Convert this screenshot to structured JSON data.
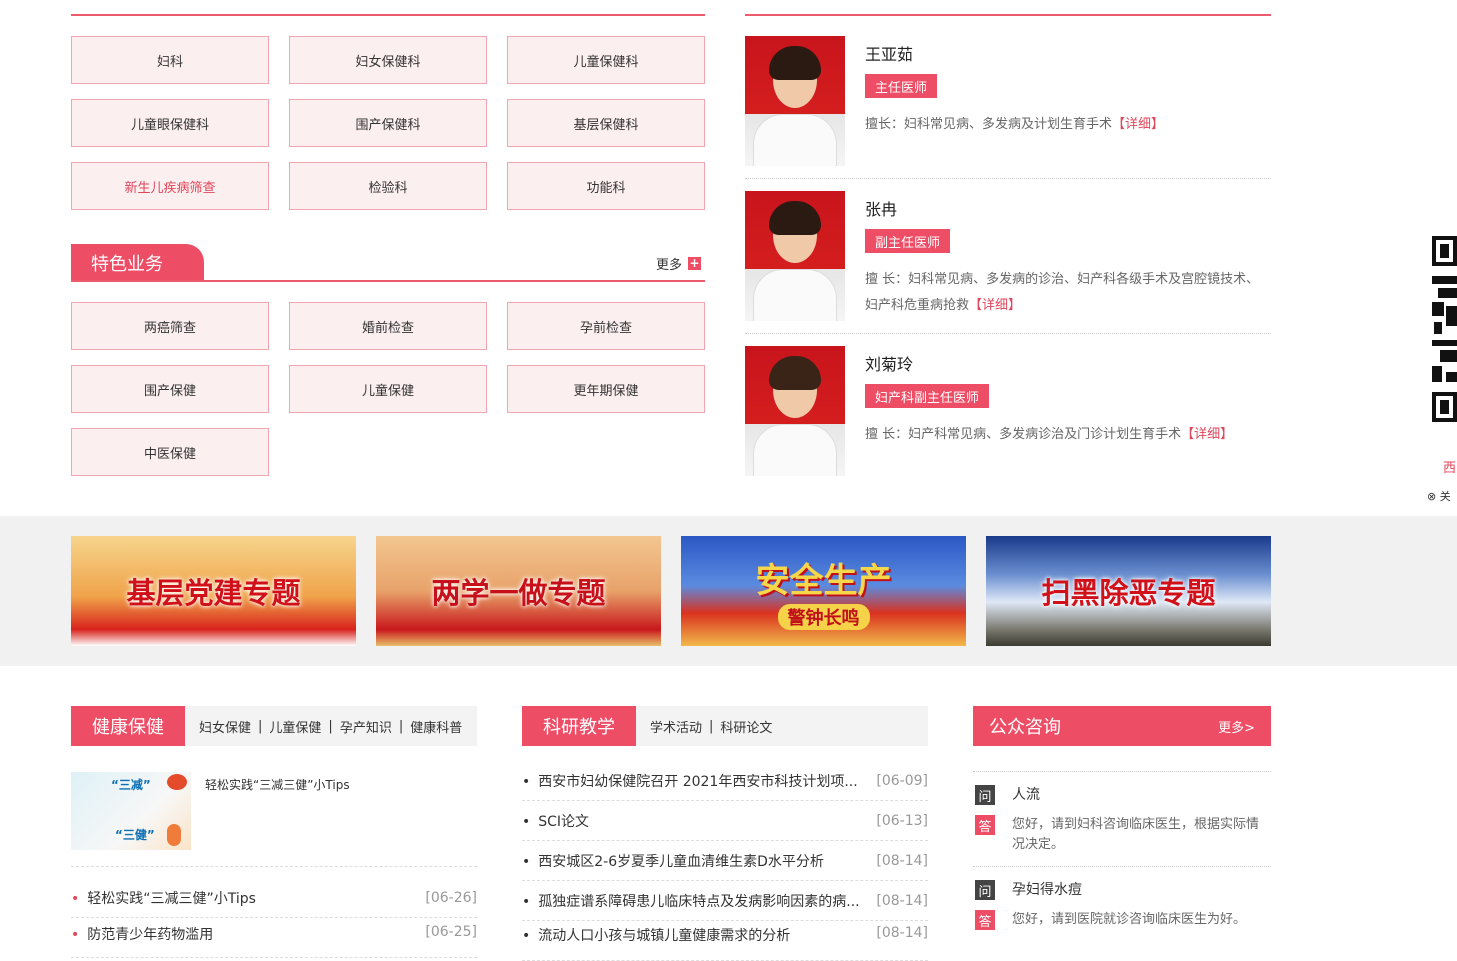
{
  "departments": {
    "items": [
      "妇科",
      "妇女保健科",
      "儿童保健科",
      "儿童眼保健科",
      "围产保健科",
      "基层保健科",
      "新生儿疾病筛查",
      "检验科",
      "功能科"
    ]
  },
  "specialty": {
    "title": "特色业务",
    "more": "更多",
    "items": [
      "两癌筛查",
      "婚前检查",
      "孕前检查",
      "围产保健",
      "儿童保健",
      "更年期保健",
      "中医保健"
    ]
  },
  "doctors": [
    {
      "name": "王亚茹",
      "title": "主任医师",
      "desc": "擅长：妇科常见病、多发病及计划生育手术",
      "detail": "【详细】"
    },
    {
      "name": "张冉",
      "title": "副主任医师",
      "desc": "擅 长：妇科常见病、多发病的诊治、妇产科各级手术及宫腔镜技术、妇产科危重病抢救",
      "detail": "【详细】"
    },
    {
      "name": "刘菊玲",
      "title": "妇产科副主任医师",
      "desc": "擅 长：妇产科常见病、多发病诊治及门诊计划生育手术",
      "detail": "【详细】"
    }
  ],
  "banners": [
    "基层党建专题",
    "两学一做专题",
    "安全生产",
    "扫黑除恶专题"
  ],
  "banner_sub": "警钟长鸣",
  "health": {
    "tab": "健康保健",
    "links": [
      "妇女保健",
      "儿童保健",
      "孕产知识",
      "健康科普"
    ],
    "feature_title": "轻松实践“三减三健”小Tips",
    "thumb_text1": "“三减”",
    "thumb_text2": "“三健”",
    "news": [
      {
        "title": "轻松实践“三减三健”小Tips",
        "date": "[06-26]"
      },
      {
        "title": "防范青少年药物滥用",
        "date": "[06-25]"
      }
    ]
  },
  "research": {
    "tab": "科研教学",
    "links": [
      "学术活动",
      "科研论文"
    ],
    "news": [
      {
        "title": "西安市妇幼保健院召开 2021年西安市科技计划项...",
        "date": "[06-09]"
      },
      {
        "title": "SCI论文",
        "date": "[06-13]"
      },
      {
        "title": "西安城区2-6岁夏季儿童血清维生素D水平分析",
        "date": "[08-14]"
      },
      {
        "title": "孤独症谱系障碍患儿临床特点及发病影响因素的病...",
        "date": "[08-14]"
      },
      {
        "title": "流动人口小孩与城镇儿童健康需求的分析",
        "date": "[08-14]"
      }
    ]
  },
  "consult": {
    "tab": "公众咨询",
    "more": "更多>",
    "q_label": "问",
    "a_label": "答",
    "items": [
      {
        "q": "人流",
        "a": "您好，请到妇科咨询临床医生，根据实际情况决定。"
      },
      {
        "q": "孕妇得水痘",
        "a": "您好，请到医院就诊咨询临床医生为好。"
      }
    ]
  },
  "side": {
    "text": "西",
    "close": "⊗ 关"
  },
  "colors": {
    "accent": "#ee4d66",
    "btn_bg": "#fcefef",
    "btn_border": "#f0a5b1"
  }
}
